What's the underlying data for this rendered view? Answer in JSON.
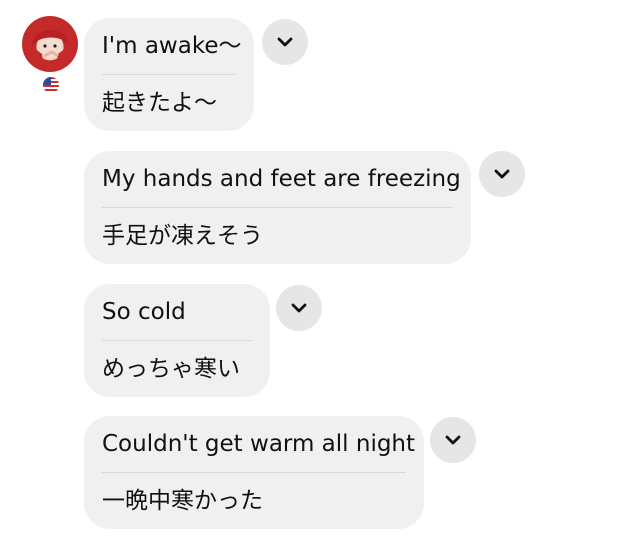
{
  "messages": [
    {
      "original": "I'm awake～",
      "translation": "起きたよ～"
    },
    {
      "original": "My hands and feet are freezing",
      "translation": "手足が凍えそう"
    },
    {
      "original": "So cold",
      "translation": "めっちゃ寒い"
    },
    {
      "original": "Couldn't get warm all night",
      "translation": "一晩中寒かった"
    }
  ],
  "sender": {
    "avatar_icon": "avatar-icon",
    "flag_icon": "us-flag-icon"
  },
  "colors": {
    "bubble": "#f0f0f0",
    "expand_button": "#e6e6e6",
    "text": "#111111"
  }
}
